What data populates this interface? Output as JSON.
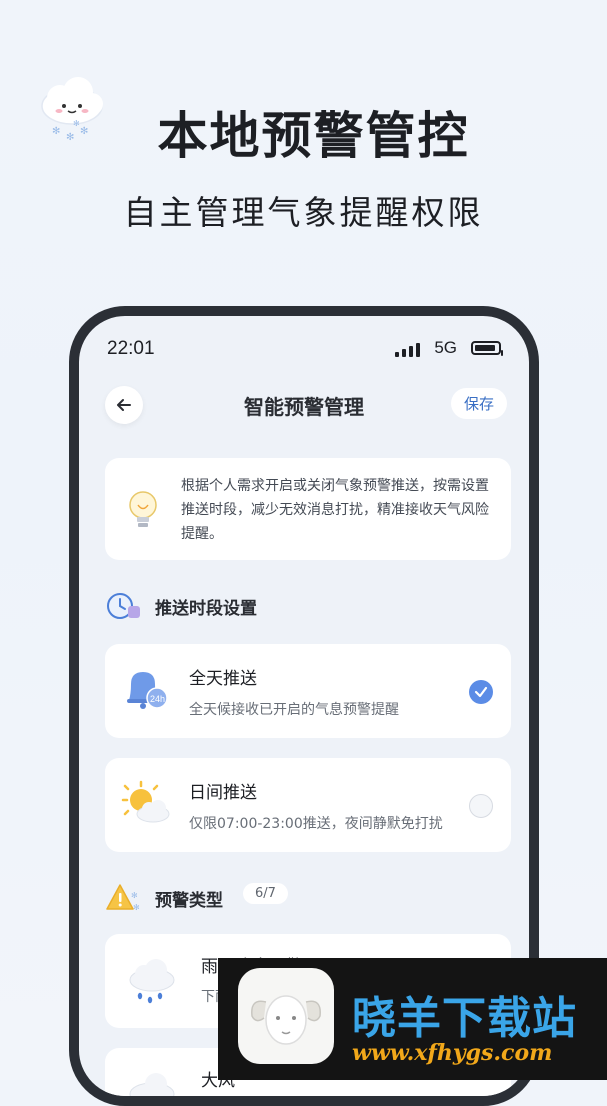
{
  "hero": {
    "title": "本地预警管控",
    "subtitle": "自主管理气象提醒权限",
    "mascot_icon": "cloud-snow-mascot-icon"
  },
  "status_bar": {
    "time": "22:01",
    "network": "5G",
    "icons": [
      "signal-icon",
      "battery-icon"
    ]
  },
  "nav": {
    "title": "智能预警管理",
    "back_icon": "back-arrow-icon",
    "save_label": "保存"
  },
  "info": {
    "icon": "lightbulb-icon",
    "text": "根据个人需求开启或关闭气象预警推送，按需设置推送时段，减少无效消息打扰，精准接收天气风险提醒。"
  },
  "push_section": {
    "icon": "clock-icon",
    "title": "推送时段设置",
    "options": [
      {
        "icon": "bell-24h-icon",
        "title": "全天推送",
        "desc": "全天候接收已开启的气息预警提醒",
        "selected": true
      },
      {
        "icon": "sun-cloud-icon",
        "title": "日间推送",
        "desc": "仅限07:00-23:00推送，夜间静默免打扰",
        "selected": false
      }
    ]
  },
  "warning_section": {
    "icon": "warning-triangle-icon",
    "title": "预警类型",
    "count": "6/7",
    "items": [
      {
        "icon": "rain-snow-cloud-icon",
        "title": "雨雪降水预警",
        "desc": "下雨"
      },
      {
        "icon": "wind-cloud-icon",
        "title": "大风",
        "desc": ""
      }
    ]
  },
  "banner": {
    "site_name": "晓羊下载站",
    "url": "www.xfhygs.com",
    "logo_icon": "sheep-logo-icon"
  },
  "colors": {
    "accent": "#5b8ce6",
    "save_text": "#3a6fc4",
    "banner_name": "#3aa5e8",
    "banner_url": "#f2a81a"
  }
}
